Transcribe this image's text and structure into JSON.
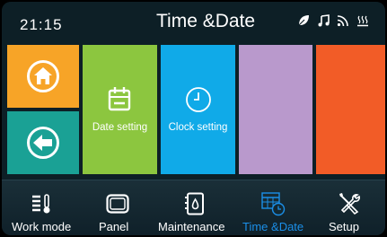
{
  "header": {
    "time": "21:15",
    "title": "Time &Date",
    "status_icons": [
      "leaf-icon",
      "music-icon",
      "wifi-icon",
      "heating-icon"
    ]
  },
  "tiles": {
    "home": {
      "icon": "home-icon",
      "color": "#f7a427"
    },
    "back": {
      "icon": "back-icon",
      "color": "#1aa195"
    },
    "date_setting": {
      "label": "Date setting",
      "icon": "calendar-icon",
      "color": "#8cc63f"
    },
    "clock_setting": {
      "label": "Clock setting",
      "icon": "clock-icon",
      "color": "#10aae8"
    },
    "blank_purple": {
      "color": "#b999cc"
    },
    "blank_orange": {
      "color": "#f25c27"
    }
  },
  "nav": {
    "items": [
      {
        "label": "Work mode",
        "icon": "thermometer-icon"
      },
      {
        "label": "Panel",
        "icon": "panel-icon"
      },
      {
        "label": "Maintenance",
        "icon": "maintenance-icon"
      },
      {
        "label": "Time &Date",
        "icon": "calendar-clock-icon",
        "active": true
      },
      {
        "label": "Setup",
        "icon": "tools-icon"
      }
    ],
    "active_color": "#1b8fe8"
  }
}
